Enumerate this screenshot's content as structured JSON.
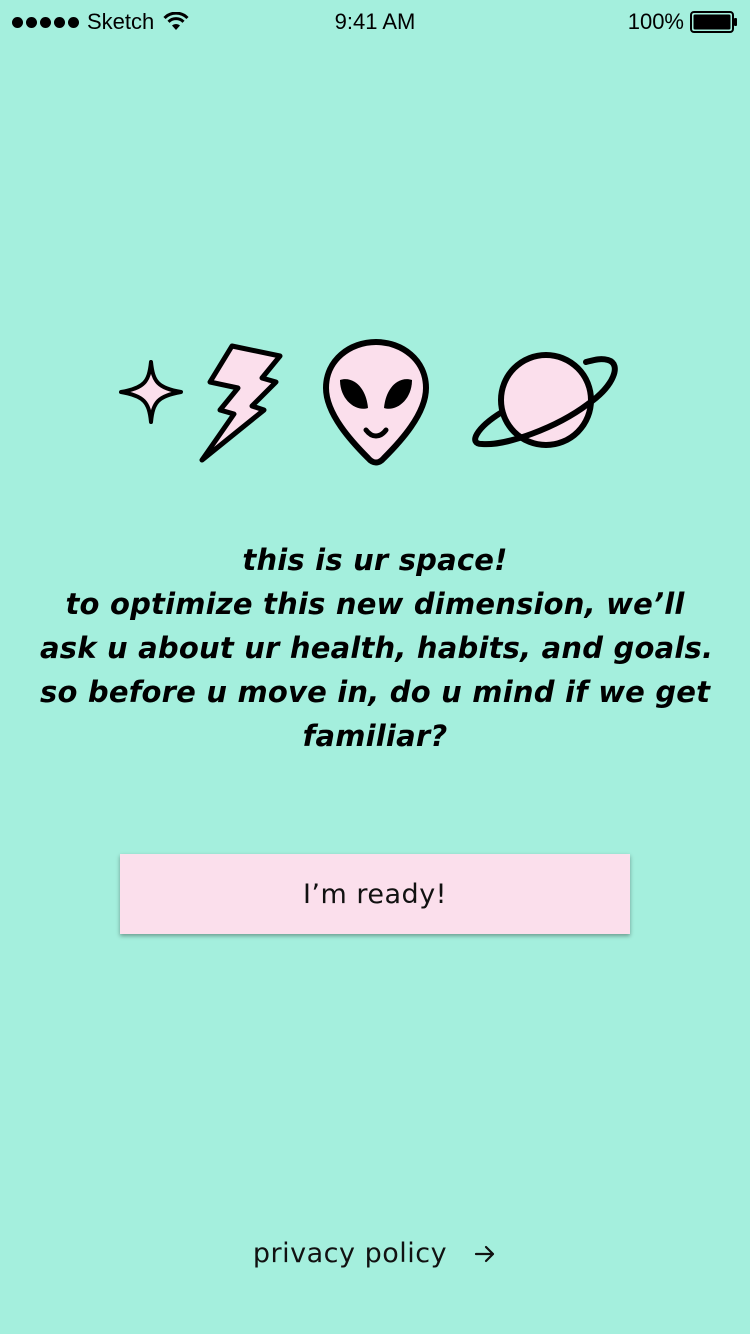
{
  "status_bar": {
    "carrier": "Sketch",
    "time": "9:41 AM",
    "battery": "100%",
    "signal_icon": "signal-dots-icon",
    "wifi_icon": "wifi-icon",
    "battery_icon": "battery-icon"
  },
  "icons": [
    "sparkle-icon",
    "lightning-bolt-icon",
    "alien-icon",
    "planet-icon"
  ],
  "message": {
    "lines": [
      "this is ur space!",
      "to optimize this new dimension, we’ll",
      "ask u about ur health, habits, and goals.",
      "so before u move in, do u mind if we get",
      "familiar?"
    ]
  },
  "ready_button": {
    "label": "I’m ready!"
  },
  "privacy": {
    "label": "privacy policy",
    "icon": "arrow-right-icon"
  },
  "colors": {
    "background": "#a4efdd",
    "accent_pink": "#fbdfec",
    "outline": "#000000"
  }
}
